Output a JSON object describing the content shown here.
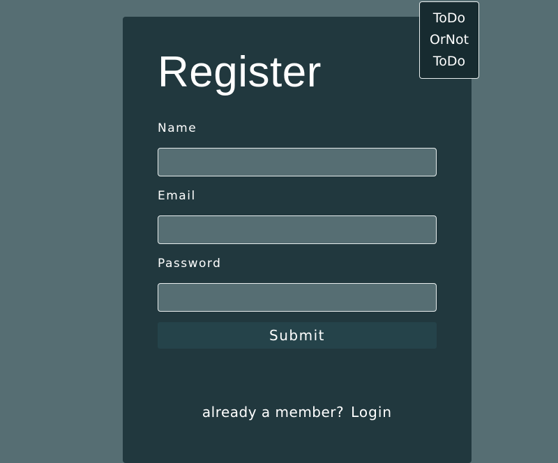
{
  "page": {
    "background_color": "#566e73"
  },
  "card": {
    "background_color": "#21383e",
    "title": "Register"
  },
  "form": {
    "name_label": "Name",
    "name_value": "",
    "email_label": "Email",
    "email_value": "",
    "password_label": "Password",
    "password_value": "",
    "input_background": "#566e73",
    "submit_label": "Submit",
    "submit_background": "#25434a"
  },
  "footer": {
    "prompt_text": "already a member?",
    "login_label": "Login"
  },
  "nav_menu": {
    "background_color": "#172b30",
    "items": [
      {
        "label": "ToDo"
      },
      {
        "label": "OrNot"
      },
      {
        "label": "ToDo"
      }
    ]
  }
}
